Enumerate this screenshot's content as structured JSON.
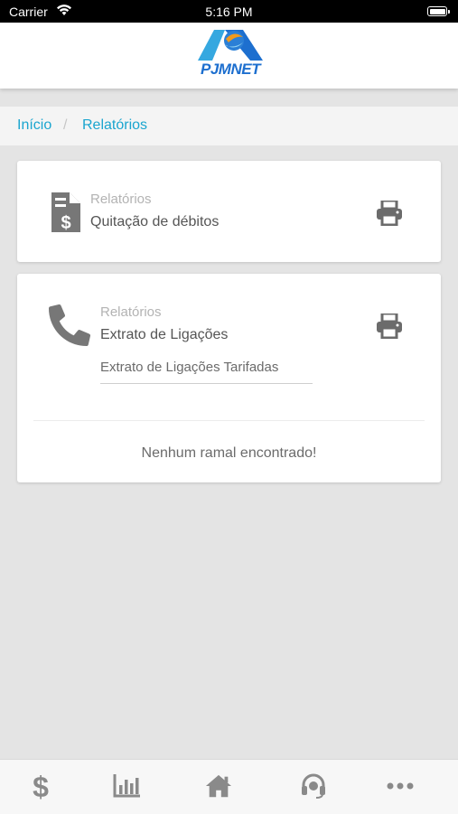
{
  "status_bar": {
    "carrier": "Carrier",
    "time": "5:16 PM"
  },
  "header": {
    "logo_text": "PJMNET",
    "logo_colors": [
      "#1d6fcf",
      "#f29a1c",
      "#35a8e0"
    ]
  },
  "breadcrumb": {
    "items": [
      "Início",
      "Relatórios"
    ],
    "separator": "/",
    "link_color": "#1aa5cf"
  },
  "cards": [
    {
      "category": "Relatórios",
      "title": "Quitação de débitos",
      "icon": "invoice-dollar-icon",
      "action_icon": "print-icon"
    },
    {
      "category": "Relatórios",
      "title": "Extrato de Ligações",
      "icon": "phone-icon",
      "action_icon": "print-icon",
      "select_value": "Extrato de Ligações Tarifadas",
      "empty_message": "Nenhum ramal encontrado!"
    }
  ],
  "tab_bar": {
    "items": [
      {
        "icon": "dollar-icon"
      },
      {
        "icon": "bar-chart-icon"
      },
      {
        "icon": "home-icon"
      },
      {
        "icon": "headset-icon"
      },
      {
        "icon": "more-icon"
      }
    ]
  }
}
